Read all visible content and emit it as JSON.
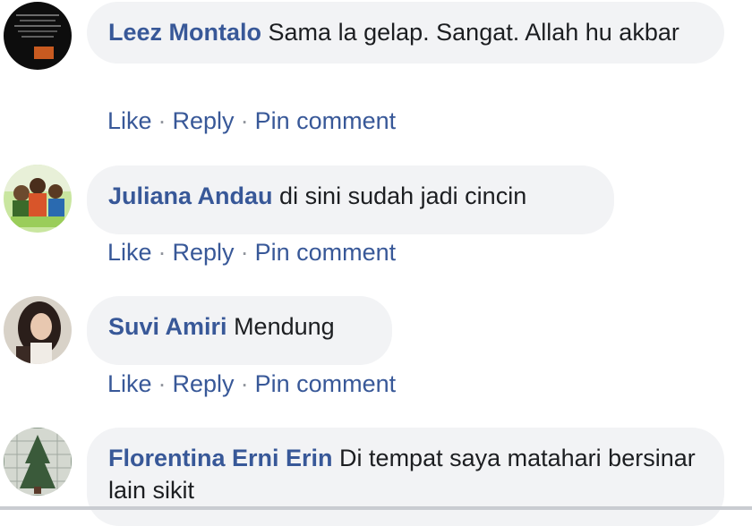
{
  "actions": {
    "like": "Like",
    "reply": "Reply",
    "pin": "Pin comment",
    "separator": "·"
  },
  "comments": [
    {
      "author": "Leez Montalo",
      "text": "Sama la gelap. Sangat. Allah hu akbar",
      "avatar_icon": "profile-photo"
    },
    {
      "author": "Juliana Andau",
      "text": "di sini sudah jadi cincin",
      "avatar_icon": "profile-photo"
    },
    {
      "author": "Suvi Amiri",
      "text": "Mendung",
      "avatar_icon": "profile-photo"
    },
    {
      "author": "Florentina Erni Erin",
      "text": "Di tempat saya matahari bersinar lain sikit",
      "avatar_icon": "profile-photo"
    }
  ],
  "colors": {
    "link": "#385898",
    "bubble": "#f2f3f5",
    "text": "#1c1e21"
  }
}
